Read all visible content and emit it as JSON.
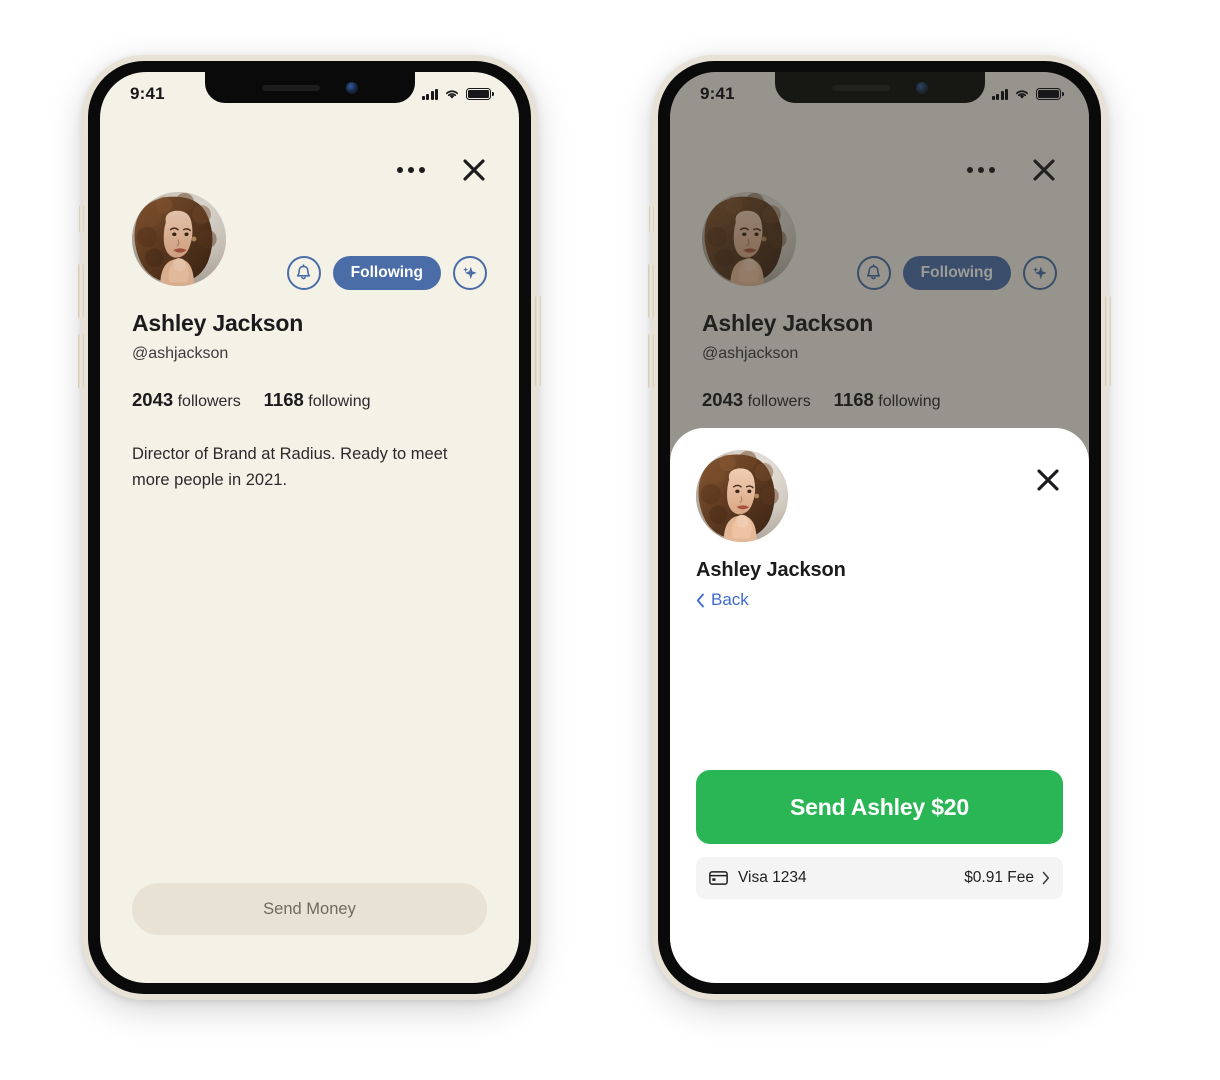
{
  "accent": {
    "blue": "#4a6da8",
    "link_blue": "#3f6bd0",
    "green": "#2BB656",
    "cream_bg": "#F4F1E7",
    "disabled_btn": "#E7E2D3",
    "scrim": "rgba(40,39,33,0.46)"
  },
  "status_bar": {
    "time": "9:41",
    "signal_icon": "cellular-signal-icon",
    "wifi_icon": "wifi-icon",
    "battery_icon": "battery-full-icon"
  },
  "profile": {
    "more_icon": "more-options-icon",
    "close_icon": "close-icon",
    "avatar_icon": "profile-avatar-image",
    "notify_icon": "bell-icon",
    "follow_label": "Following",
    "sparkle_icon": "sparkle-icon",
    "display_name": "Ashley Jackson",
    "handle": "@ashjackson",
    "followers_count": "2043",
    "followers_label": "followers",
    "following_count": "1168",
    "following_label": "following",
    "bio": "Director of Brand at Radius. Ready to meet more people in 2021.",
    "send_money_label": "Send Money"
  },
  "pay_sheet": {
    "avatar_icon": "profile-avatar-image",
    "close_icon": "close-icon",
    "recipient_name": "Ashley Jackson",
    "back_label": "Back",
    "back_chevron_icon": "chevron-left-icon",
    "cta_label": "Send Ashley $20",
    "payment_method_icon": "credit-card-icon",
    "payment_method": "Visa 1234",
    "fee_label": "$0.91 Fee",
    "chevron_icon": "chevron-right-icon"
  }
}
